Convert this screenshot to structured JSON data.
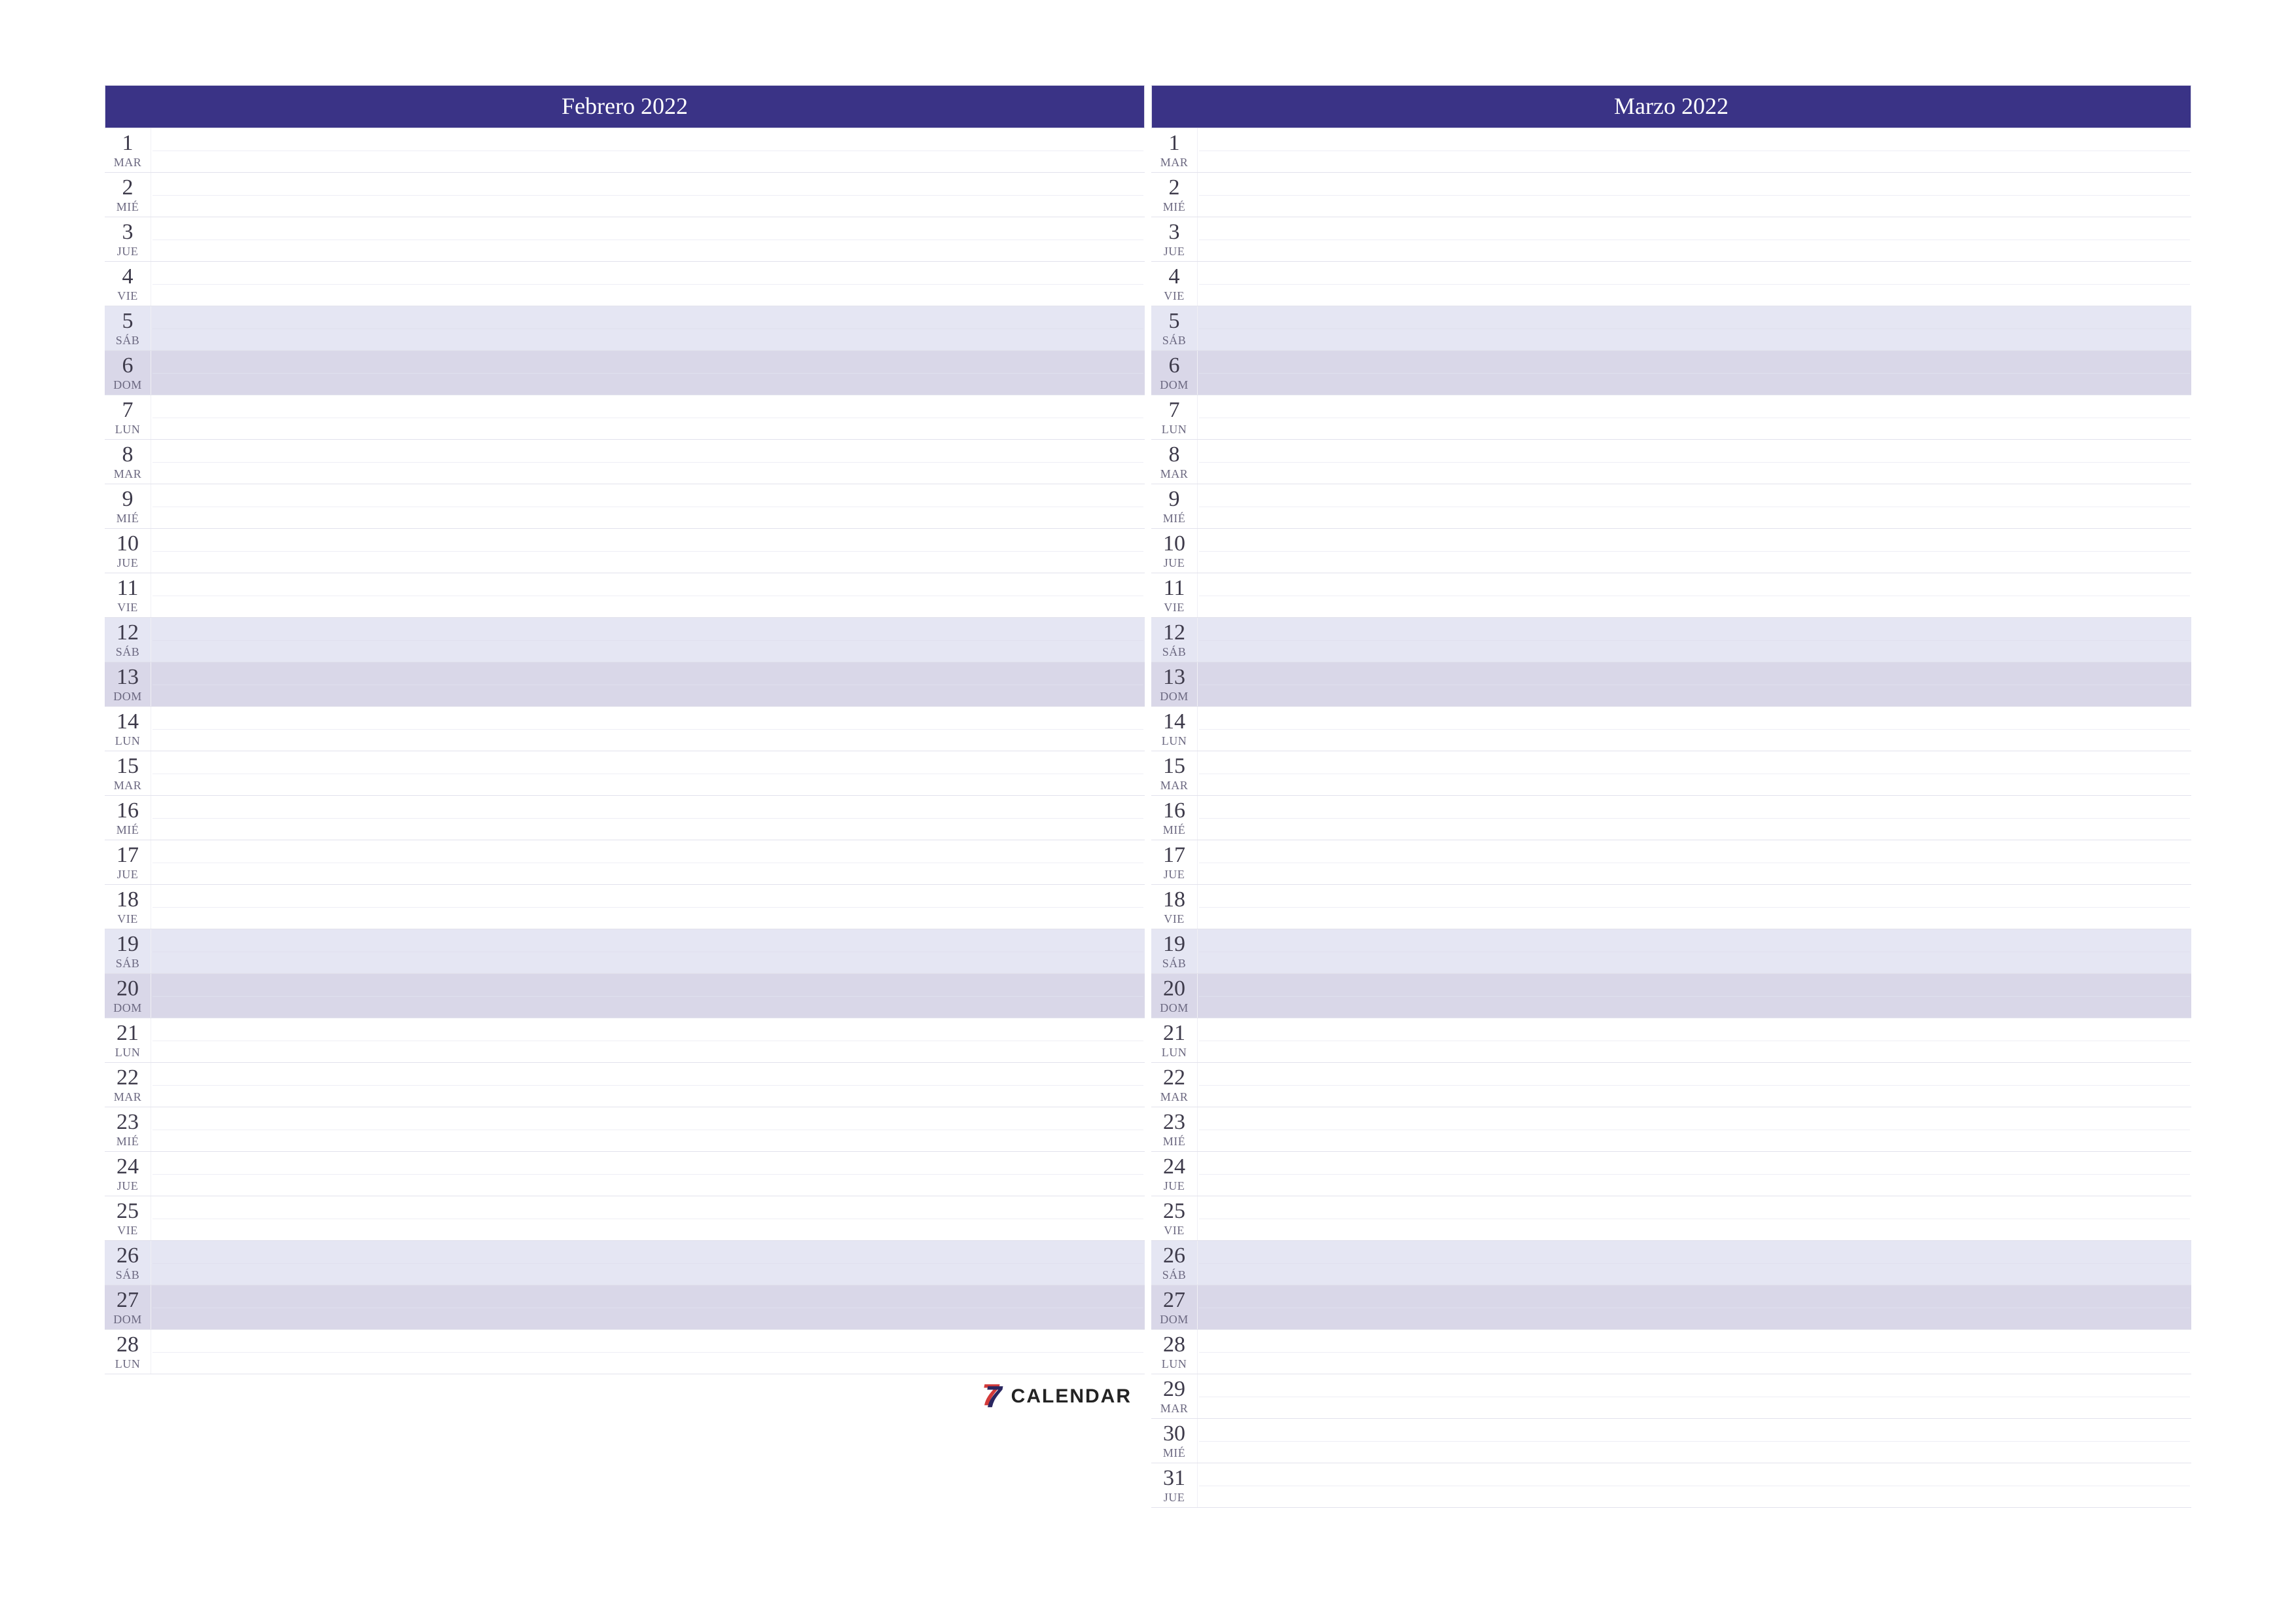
{
  "logo_text": "CALENDAR",
  "months": [
    {
      "title": "Febrero 2022",
      "days": [
        {
          "n": "1",
          "a": "MAR",
          "t": "wd"
        },
        {
          "n": "2",
          "a": "MIÉ",
          "t": "wd"
        },
        {
          "n": "3",
          "a": "JUE",
          "t": "wd"
        },
        {
          "n": "4",
          "a": "VIE",
          "t": "wd"
        },
        {
          "n": "5",
          "a": "SÁB",
          "t": "sat"
        },
        {
          "n": "6",
          "a": "DOM",
          "t": "sun"
        },
        {
          "n": "7",
          "a": "LUN",
          "t": "wd"
        },
        {
          "n": "8",
          "a": "MAR",
          "t": "wd"
        },
        {
          "n": "9",
          "a": "MIÉ",
          "t": "wd"
        },
        {
          "n": "10",
          "a": "JUE",
          "t": "wd"
        },
        {
          "n": "11",
          "a": "VIE",
          "t": "wd"
        },
        {
          "n": "12",
          "a": "SÁB",
          "t": "sat"
        },
        {
          "n": "13",
          "a": "DOM",
          "t": "sun"
        },
        {
          "n": "14",
          "a": "LUN",
          "t": "wd"
        },
        {
          "n": "15",
          "a": "MAR",
          "t": "wd"
        },
        {
          "n": "16",
          "a": "MIÉ",
          "t": "wd"
        },
        {
          "n": "17",
          "a": "JUE",
          "t": "wd"
        },
        {
          "n": "18",
          "a": "VIE",
          "t": "wd"
        },
        {
          "n": "19",
          "a": "SÁB",
          "t": "sat"
        },
        {
          "n": "20",
          "a": "DOM",
          "t": "sun"
        },
        {
          "n": "21",
          "a": "LUN",
          "t": "wd"
        },
        {
          "n": "22",
          "a": "MAR",
          "t": "wd"
        },
        {
          "n": "23",
          "a": "MIÉ",
          "t": "wd"
        },
        {
          "n": "24",
          "a": "JUE",
          "t": "wd"
        },
        {
          "n": "25",
          "a": "VIE",
          "t": "wd"
        },
        {
          "n": "26",
          "a": "SÁB",
          "t": "sat"
        },
        {
          "n": "27",
          "a": "DOM",
          "t": "sun"
        },
        {
          "n": "28",
          "a": "LUN",
          "t": "wd"
        }
      ]
    },
    {
      "title": "Marzo 2022",
      "days": [
        {
          "n": "1",
          "a": "MAR",
          "t": "wd"
        },
        {
          "n": "2",
          "a": "MIÉ",
          "t": "wd"
        },
        {
          "n": "3",
          "a": "JUE",
          "t": "wd"
        },
        {
          "n": "4",
          "a": "VIE",
          "t": "wd"
        },
        {
          "n": "5",
          "a": "SÁB",
          "t": "sat"
        },
        {
          "n": "6",
          "a": "DOM",
          "t": "sun"
        },
        {
          "n": "7",
          "a": "LUN",
          "t": "wd"
        },
        {
          "n": "8",
          "a": "MAR",
          "t": "wd"
        },
        {
          "n": "9",
          "a": "MIÉ",
          "t": "wd"
        },
        {
          "n": "10",
          "a": "JUE",
          "t": "wd"
        },
        {
          "n": "11",
          "a": "VIE",
          "t": "wd"
        },
        {
          "n": "12",
          "a": "SÁB",
          "t": "sat"
        },
        {
          "n": "13",
          "a": "DOM",
          "t": "sun"
        },
        {
          "n": "14",
          "a": "LUN",
          "t": "wd"
        },
        {
          "n": "15",
          "a": "MAR",
          "t": "wd"
        },
        {
          "n": "16",
          "a": "MIÉ",
          "t": "wd"
        },
        {
          "n": "17",
          "a": "JUE",
          "t": "wd"
        },
        {
          "n": "18",
          "a": "VIE",
          "t": "wd"
        },
        {
          "n": "19",
          "a": "SÁB",
          "t": "sat"
        },
        {
          "n": "20",
          "a": "DOM",
          "t": "sun"
        },
        {
          "n": "21",
          "a": "LUN",
          "t": "wd"
        },
        {
          "n": "22",
          "a": "MAR",
          "t": "wd"
        },
        {
          "n": "23",
          "a": "MIÉ",
          "t": "wd"
        },
        {
          "n": "24",
          "a": "JUE",
          "t": "wd"
        },
        {
          "n": "25",
          "a": "VIE",
          "t": "wd"
        },
        {
          "n": "26",
          "a": "SÁB",
          "t": "sat"
        },
        {
          "n": "27",
          "a": "DOM",
          "t": "sun"
        },
        {
          "n": "28",
          "a": "LUN",
          "t": "wd"
        },
        {
          "n": "29",
          "a": "MAR",
          "t": "wd"
        },
        {
          "n": "30",
          "a": "MIÉ",
          "t": "wd"
        },
        {
          "n": "31",
          "a": "JUE",
          "t": "wd"
        }
      ]
    }
  ]
}
